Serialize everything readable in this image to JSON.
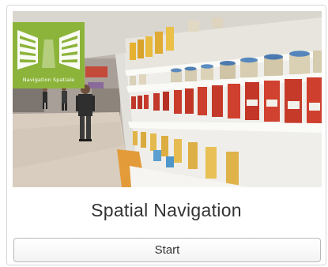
{
  "card": {
    "logo_text": "Navigation Spatiale",
    "title": "Spatial Navigation",
    "start_label": "Start"
  },
  "colors": {
    "logo_green": "#8cb43a",
    "shelf_white": "#f4f3ef",
    "card_border": "#d6d6d6",
    "title_text": "#333333"
  },
  "icons": {
    "logo": "supermarket-shelves-icon"
  }
}
